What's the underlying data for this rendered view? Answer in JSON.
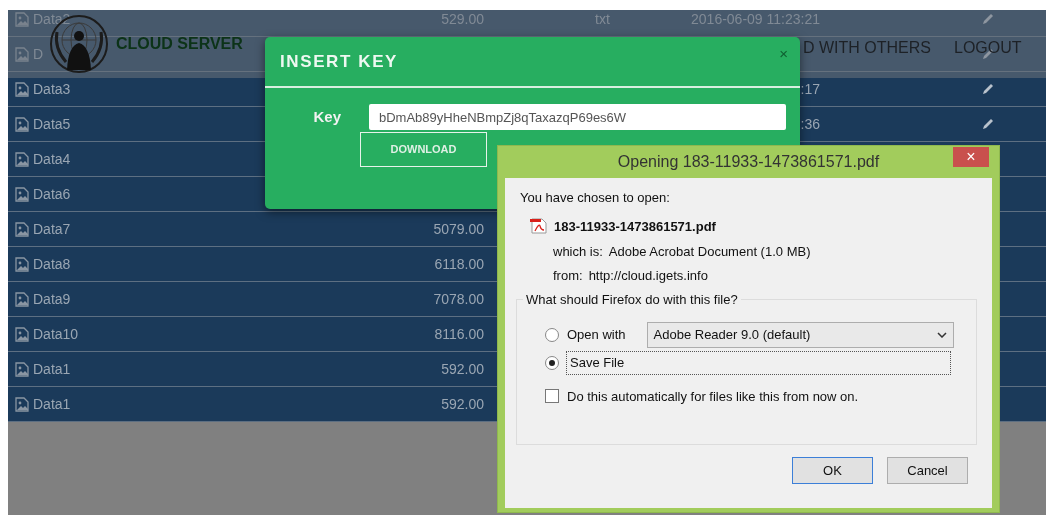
{
  "table": {
    "rows": [
      {
        "name": "Data2",
        "column_2": "529.00",
        "column_3": "txt",
        "column_4": "2016-06-09 11:23:21",
        "edit_icon": true
      },
      {
        "name": "D",
        "edit_icon": true
      },
      {
        "name": "Data3",
        "column_4": ":17",
        "edit_icon": true
      },
      {
        "name": "Data5",
        "column_4": ":36",
        "edit_icon": true
      },
      {
        "name": "Data4",
        "edit_icon": false
      },
      {
        "name": "Data6",
        "edit_icon": false
      },
      {
        "name": "Data7",
        "column_2": "5079.00",
        "edit_icon": false
      },
      {
        "name": "Data8",
        "column_2": "6118.00",
        "edit_icon": false
      },
      {
        "name": "Data9",
        "column_2": "7078.00",
        "edit_icon": false
      },
      {
        "name": "Data10",
        "column_2": "8116.00",
        "edit_icon": false
      },
      {
        "name": "Data1",
        "column_2": "592.00",
        "edit_icon": false
      },
      {
        "name": "Data1",
        "column_2": "592.00",
        "edit_icon": false
      }
    ]
  },
  "navbar": {
    "brand": "CLOUD SERVER",
    "links": [
      "D WITH OTHERS",
      "LOGOUT"
    ]
  },
  "modal": {
    "title": "INSERT KEY",
    "close": "×",
    "key_label": "Key",
    "key_value": "bDmAb89yHheNBmpZj8qTaxazqP69es6W",
    "button": "DOWNLOAD"
  },
  "dialog": {
    "title": "Opening 183-11933-1473861571.pdf",
    "close": "×",
    "intro": "You have chosen to open:",
    "filename": "183-11933-1473861571.pdf",
    "which_is_label": "which is:",
    "which_is_value": "Adobe Acrobat Document (1.0 MB)",
    "from_label": "from:",
    "from_value": "http://cloud.igets.info",
    "group_label": "What should Firefox do with this file?",
    "options": [
      {
        "kind": "open_with",
        "label": "Open with",
        "selected": false,
        "focused": false,
        "app": "Adobe Reader 9.0 (default)"
      },
      {
        "kind": "plain",
        "label": "Save File",
        "selected": true,
        "focused": true
      }
    ],
    "checkbox": {
      "label": "Do this automatically for files like this from now on.",
      "checked": false
    },
    "buttons": [
      {
        "label": "OK",
        "default": true
      },
      {
        "label": "Cancel",
        "default": false
      }
    ]
  }
}
